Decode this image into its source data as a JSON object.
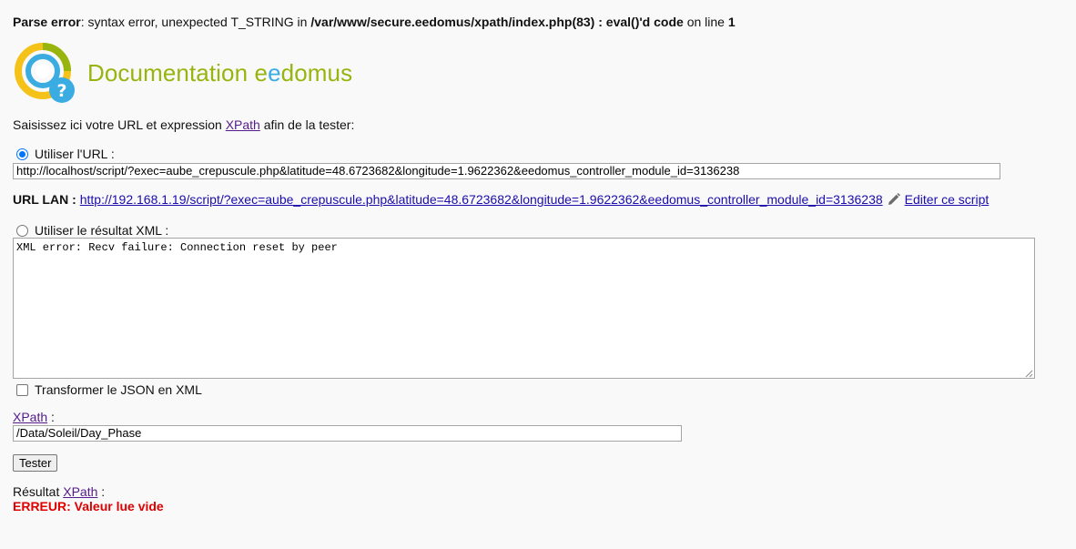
{
  "parse_error": {
    "label": "Parse error",
    "message_part1": ": syntax error, unexpected T_STRING in ",
    "file": "/var/www/secure.eedomus/xpath/index.php(83) : eval()'d code",
    "message_part2": " on line ",
    "line": "1"
  },
  "header": {
    "title_prefix": "Documentation ",
    "title_e1": "e",
    "title_e2": "e",
    "title_suffix": "domus"
  },
  "intro": {
    "text_before": "Saisissez ici votre URL et expression ",
    "link": "XPath",
    "text_after": " afin de la tester:"
  },
  "url_option": {
    "label": "Utiliser l'URL :",
    "value": "http://localhost/script/?exec=aube_crepuscule.php&latitude=48.6723682&longitude=1.9622362&eedomus_controller_module_id=3136238"
  },
  "url_lan": {
    "label": "URL LAN :",
    "link": "http://192.168.1.19/script/?exec=aube_crepuscule.php&latitude=48.6723682&longitude=1.9622362&eedomus_controller_module_id=3136238",
    "edit_link": "Editer ce script"
  },
  "xml_option": {
    "label": "Utiliser le résultat XML :",
    "content": "XML error: Recv failure: Connection reset by peer"
  },
  "json_option": {
    "label": "Transformer le JSON en XML"
  },
  "xpath": {
    "link": "XPath",
    "suffix": " :",
    "value": "/Data/Soleil/Day_Phase"
  },
  "test_button": {
    "label": "Tester"
  },
  "result": {
    "prefix": "Résultat ",
    "link": "XPath",
    "suffix": " :",
    "error": "ERREUR: Valeur lue vide"
  },
  "colors": {
    "brand_green": "#97b40f",
    "brand_blue": "#3aace2",
    "error_red": "#e00000",
    "link_blue": "#1a0dab",
    "link_visited": "#551a8b"
  }
}
